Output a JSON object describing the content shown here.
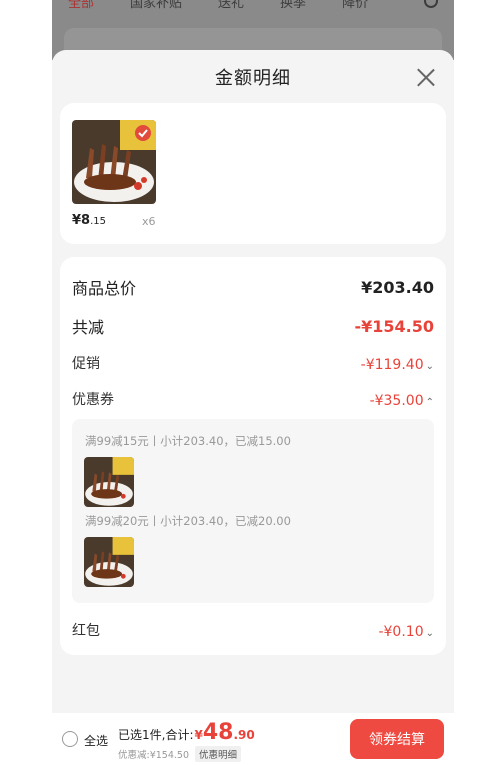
{
  "background_tabs": [
    "全部",
    "国家补贴",
    "送礼",
    "换季",
    "降价"
  ],
  "sheet": {
    "title": "金额明细"
  },
  "product": {
    "price_int": "¥8",
    "price_dec": ".15",
    "qty": "x6"
  },
  "summary": {
    "total_label": "商品总价",
    "total_value": "¥203.40",
    "reduce_label": "共减",
    "reduce_value": "-¥154.50",
    "promo_label": "促销",
    "promo_value": "-¥119.40",
    "coupon_label": "优惠券",
    "coupon_value": "-¥35.00",
    "redpacket_label": "红包",
    "redpacket_value": "-¥0.10"
  },
  "coupons": [
    {
      "text": "满99减15元丨小计203.40，已减15.00"
    },
    {
      "text": "满99减20元丨小计203.40，已减20.00"
    }
  ],
  "bottom": {
    "select_all": "全选",
    "selected_text": "已选1件,合计:",
    "currency": "¥",
    "total_int": "48",
    "total_dec": ".90",
    "discount_text": "优惠减:¥154.50",
    "detail_btn": "优惠明细",
    "checkout": "领券结算"
  },
  "colors": {
    "accent": "#e8433a",
    "button": "#ee4a41"
  }
}
